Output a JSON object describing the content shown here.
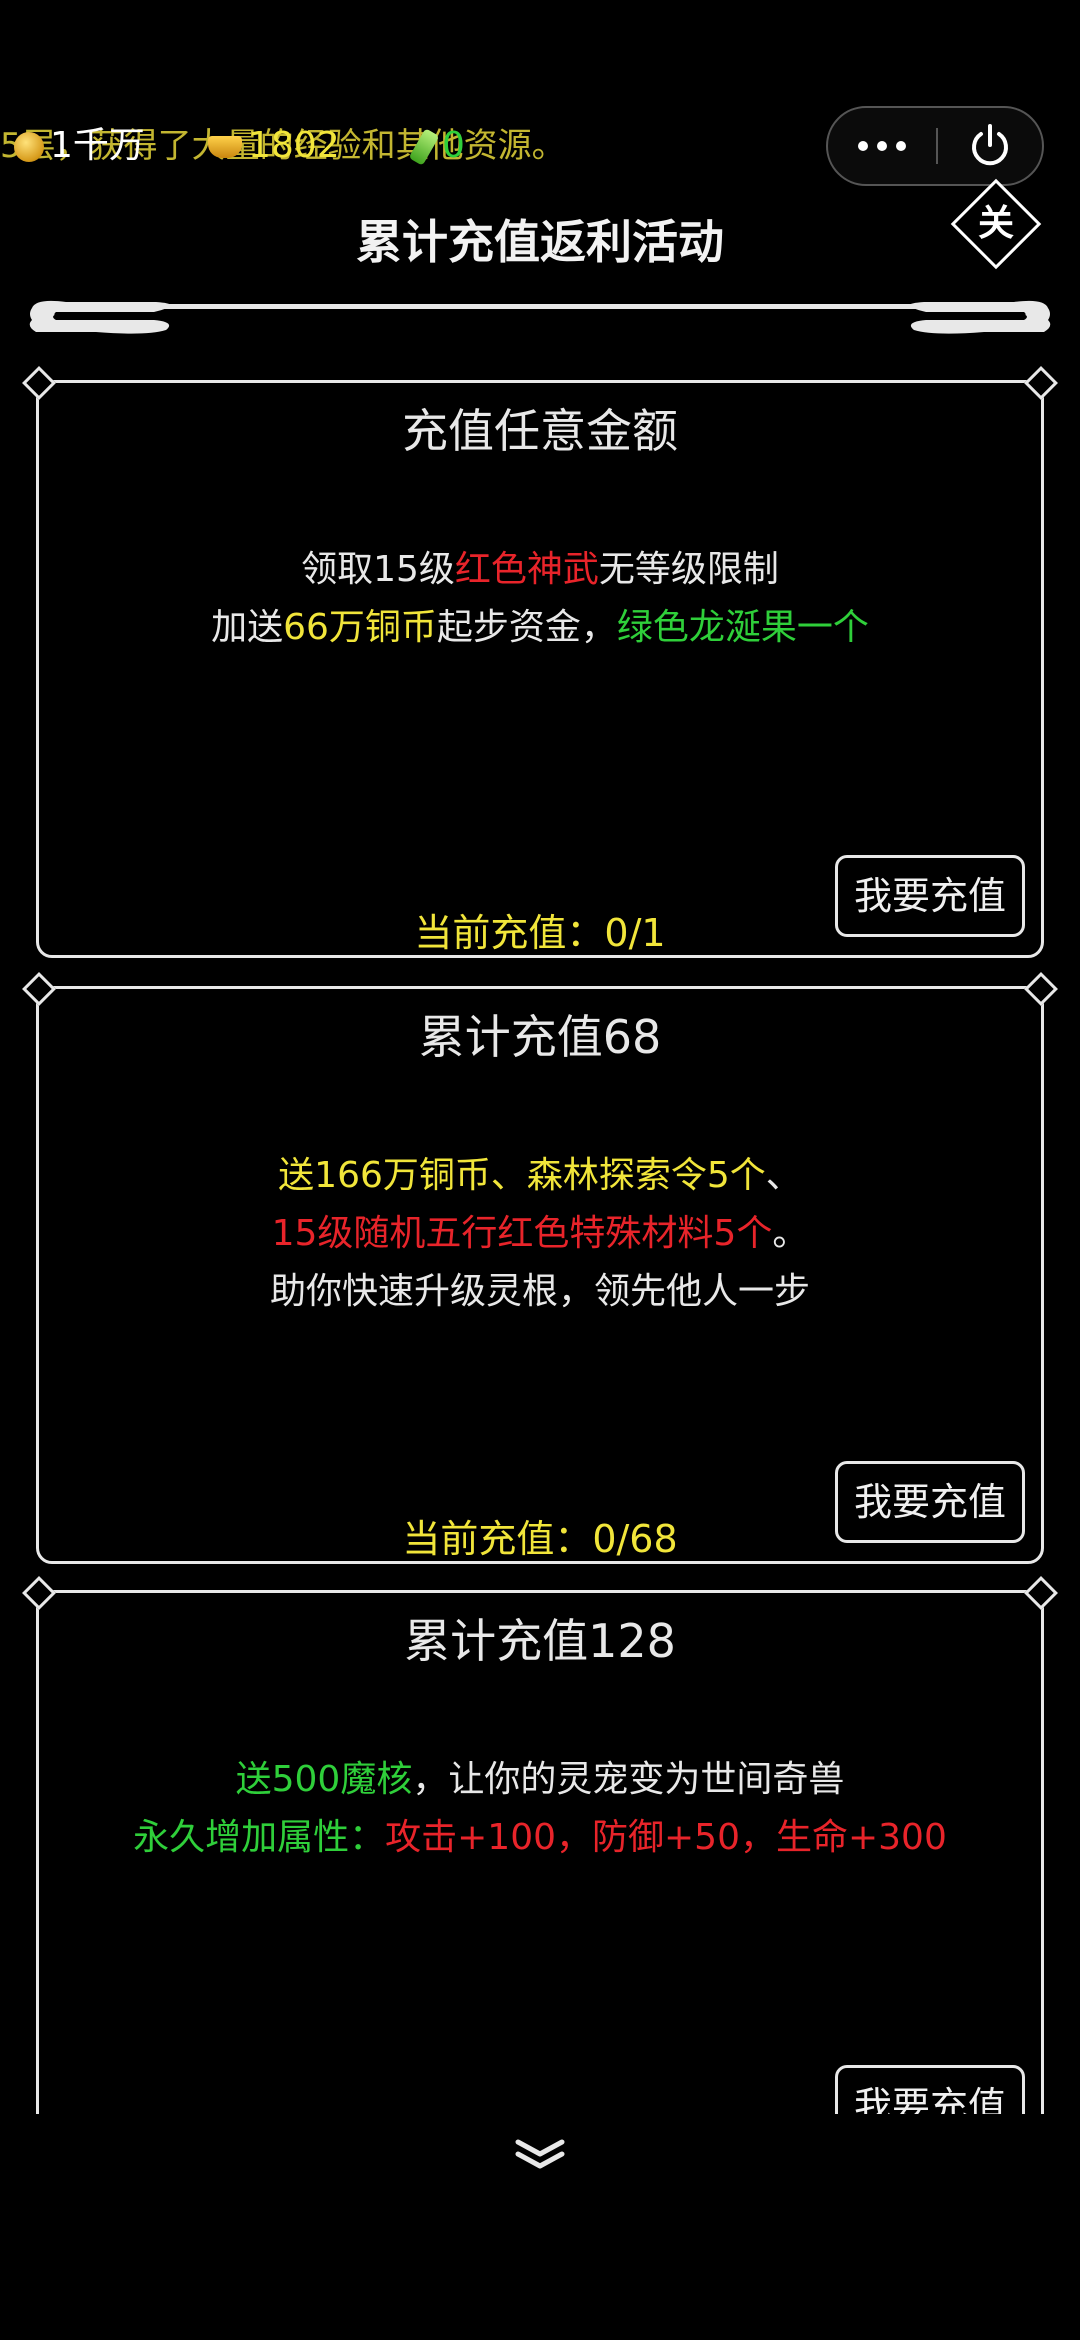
{
  "status": {
    "copper": "1千万",
    "gold": "1802",
    "jade": "0",
    "ticker": "5层，获得了大量的经验和其他资源。"
  },
  "capsule": {
    "more_icon": "more-dots-icon",
    "power_icon": "power-icon"
  },
  "close_label": "关",
  "page_title": "累计充值返利活动",
  "button_label": "我要充值",
  "cards": [
    {
      "title": "充值任意金额",
      "lines": [
        [
          {
            "text": "领取15级",
            "color": "white"
          },
          {
            "text": "红色神武",
            "color": "red"
          },
          {
            "text": "无等级限制",
            "color": "white"
          }
        ],
        [
          {
            "text": "加送",
            "color": "white"
          },
          {
            "text": "66万铜币",
            "color": "yellow"
          },
          {
            "text": "起步资金，",
            "color": "white"
          },
          {
            "text": "绿色龙涎果一个",
            "color": "green"
          }
        ]
      ],
      "progress": "当前充值：0/1"
    },
    {
      "title": "累计充值68",
      "lines": [
        [
          {
            "text": "送166万铜币、森林探索令5个",
            "color": "yellow"
          },
          {
            "text": "、",
            "color": "white"
          }
        ],
        [
          {
            "text": "15级随机五行红色特殊材料5个",
            "color": "red"
          },
          {
            "text": "。",
            "color": "white"
          }
        ],
        [
          {
            "text": "助你快速升级灵根，领先他人一步",
            "color": "white"
          }
        ]
      ],
      "progress": "当前充值：0/68"
    },
    {
      "title": "累计充值128",
      "lines": [
        [
          {
            "text": "送500魔核",
            "color": "green"
          },
          {
            "text": "，让你的灵宠变为世间奇兽",
            "color": "white"
          }
        ],
        [
          {
            "text": "永久增加属性：",
            "color": "green"
          },
          {
            "text": "攻击+100，防御+50，生命+300",
            "color": "red"
          }
        ]
      ],
      "progress": ""
    }
  ],
  "colors": {
    "red": "#e8242a",
    "yellow": "#f1e53a",
    "green": "#2fcf3a",
    "white": "#e8e8e8",
    "background": "#000000"
  }
}
